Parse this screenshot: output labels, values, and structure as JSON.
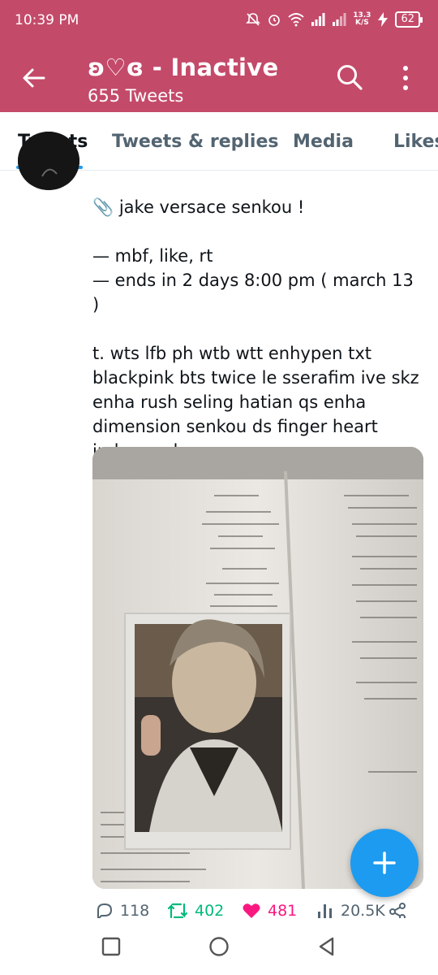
{
  "status_bar": {
    "time": "10:39 PM",
    "speed_value": "13.3",
    "speed_unit": "K/S",
    "battery": "62"
  },
  "header": {
    "title": "ʚ♡ɞ - Inactive",
    "subtitle": "655 Tweets",
    "back_icon": "arrow-left-icon",
    "search_icon": "search-icon",
    "more_icon": "more-vertical-icon"
  },
  "tabs": [
    {
      "label": "Tweets",
      "active": true
    },
    {
      "label": "Tweets & replies",
      "active": false
    },
    {
      "label": "Media",
      "active": false
    },
    {
      "label": "Likes",
      "active": false
    }
  ],
  "tweet": {
    "lines": [
      "📎 jake versace senkou !",
      "— mbf, like, rt",
      "— ends in 2 days 8:00 pm ( march 13 )",
      "t. wts lfb ph wtb wtt enhypen txt blackpink bts twice le sserafim ive skz enha rush seling hatian qs enha dimension senkou ds finger heart indemand"
    ],
    "stats": {
      "replies": "118",
      "retweets": "402",
      "likes": "481",
      "views": "20.5K"
    }
  },
  "colors": {
    "header_bg": "#c44a6a",
    "accent": "#1d9bf0",
    "retweet": "#00ba7c",
    "like": "#f91880"
  },
  "navbar": {
    "recents_icon": "square-icon",
    "home_icon": "circle-icon",
    "back_icon": "triangle-back-icon"
  }
}
